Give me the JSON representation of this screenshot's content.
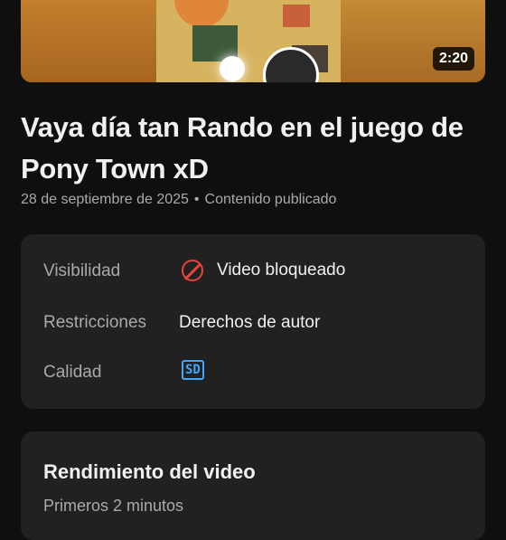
{
  "video": {
    "duration": "2:20",
    "title": "Vaya día tan Rando en el juego de Pony Town xD",
    "date": "28 de septiembre de 2025",
    "separator": "•",
    "status": "Contenido publicado"
  },
  "details": {
    "visibility_label": "Visibilidad",
    "visibility_value": "Video bloqueado",
    "visibility_icon": "blocked-icon",
    "restrictions_label": "Restricciones",
    "restrictions_value": "Derechos de autor",
    "quality_label": "Calidad",
    "quality_badge": "SD"
  },
  "performance": {
    "title": "Rendimiento del video",
    "subtitle": "Primeros 2 minutos"
  },
  "colors": {
    "background": "#0f0f0f",
    "card": "#212121",
    "blocked": "#e5453b",
    "sd_badge": "#3ea6ff"
  }
}
